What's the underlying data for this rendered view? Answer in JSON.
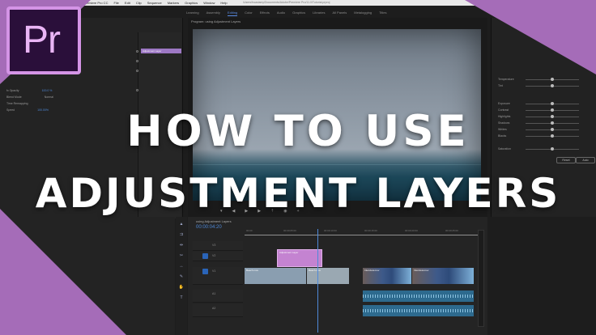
{
  "menubar": {
    "items": [
      "Premiere Pro CC",
      "File",
      "Edit",
      "Clip",
      "Sequence",
      "Markers",
      "Graphics",
      "Window",
      "Help"
    ],
    "path": "/Users/fxcadamy/Documents/Adobe/Premiere Pro/11.0/Tutorial.prproj"
  },
  "workspaces": [
    "Learning",
    "Assembly",
    "Editing",
    "Color",
    "Effects",
    "Audio",
    "Graphics",
    "Libraries",
    "All Panels",
    "Metalogging",
    "Titles"
  ],
  "active_workspace": "Editing",
  "effect_controls": {
    "rows": [
      {
        "label": "fx Opacity",
        "value": "100.0 %"
      },
      {
        "label": "Blend Mode",
        "value": "Normal"
      },
      {
        "label": "Time Remapping",
        "value": ""
      },
      {
        "label": "Speed",
        "value": "100.00%"
      }
    ],
    "clip_label": "Adjustment Layer"
  },
  "program": {
    "title": "Program: using Adjustment Layers"
  },
  "lumetri": {
    "rows": [
      {
        "label": "Temperature"
      },
      {
        "label": "Tint"
      },
      {
        "label": "Exposure"
      },
      {
        "label": "Contrast"
      },
      {
        "label": "Highlights"
      },
      {
        "label": "Shadows"
      },
      {
        "label": "Whites"
      },
      {
        "label": "Blacks"
      },
      {
        "label": "Saturation"
      }
    ],
    "levels": [
      0.5,
      0.5,
      0.5,
      0.5,
      0.5,
      0.5,
      0.5,
      0.5,
      0.5
    ],
    "reset_label": "Reset",
    "auto_label": "Auto"
  },
  "timeline": {
    "title": "using Adjustment Layers",
    "timecode": "00:00:04:20",
    "ruler": [
      "00:00",
      "00:00:05:00",
      "00:00:10:00",
      "00:00:15:00",
      "00:00:20:00",
      "00:00:25:00"
    ],
    "tracks": [
      "V3",
      "V2",
      "V1",
      "A1",
      "A2"
    ],
    "adj_clip": "Adjustment Layer",
    "v1_clips": [
      "Beach.mov",
      "Beach.mov",
      "Interview.mov",
      "Interview.mov"
    ]
  },
  "headline": {
    "line1": "HOW TO USE",
    "line2": "ADJUSTMENT LAYERS"
  },
  "logo": {
    "text": "Pr"
  },
  "colors": {
    "accent": "#5a8ce6",
    "brand_purple": "#a56cb8",
    "logo_bg": "#2a0f3a",
    "logo_border": "#d494e6"
  }
}
